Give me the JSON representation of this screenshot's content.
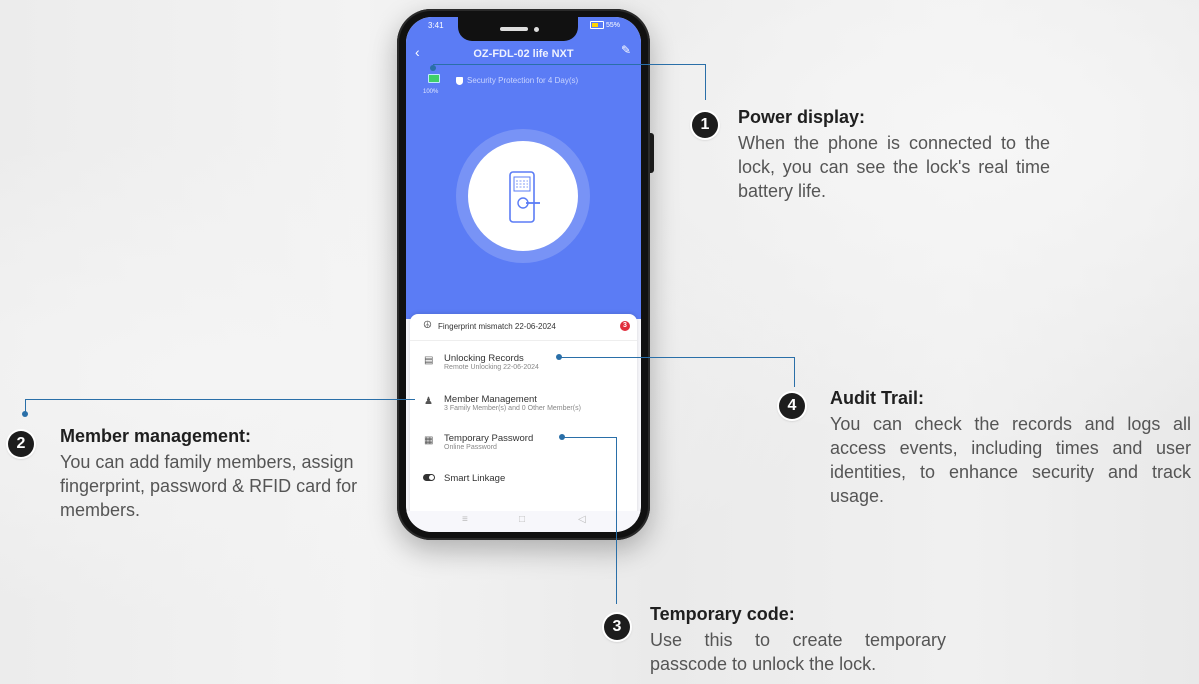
{
  "phone": {
    "status_time": "3:41",
    "status_battery": "55%",
    "title": "OZ-FDL-02 life NXT",
    "battery_level": "100%",
    "security_text": "Security Protection for 4 Day(s)",
    "notification": {
      "text": "Fingerprint mismatch 22-06-2024",
      "badge": "3"
    },
    "menu": [
      {
        "title": "Unlocking Records",
        "subtitle": "Remote Unlocking 22-06-2024"
      },
      {
        "title": "Member Management",
        "subtitle": "3 Family Member(s) and 0 Other Member(s)"
      },
      {
        "title": "Temporary Password",
        "subtitle": "Online Password"
      }
    ],
    "smart_linkage": "Smart Linkage"
  },
  "callouts": [
    {
      "number": "1",
      "title": "Power display:",
      "body": "When the phone is connected to the lock, you can see the lock's real time battery life."
    },
    {
      "number": "2",
      "title": "Member management:",
      "body": "You can add family members, assign fingerprint, password & RFID card for members."
    },
    {
      "number": "3",
      "title": "Temporary code:",
      "body": "Use this to create temporary passcode to unlock the lock."
    },
    {
      "number": "4",
      "title": "Audit Trail:",
      "body": "You can check the records and logs all access events, including times and user identities, to enhance security and track usage."
    }
  ],
  "colors": {
    "app_blue": "#5b7cf5",
    "callout_line": "#2a6fa8",
    "badge": "#1d1d1d"
  },
  "icons": [
    "back-arrow-icon",
    "edit-icon",
    "battery-icon",
    "shield-icon",
    "door-lock-icon",
    "speaker-icon",
    "records-icon",
    "members-icon",
    "keypad-icon",
    "toggle-icon",
    "menu-nav-icon",
    "home-nav-icon",
    "back-nav-icon"
  ]
}
